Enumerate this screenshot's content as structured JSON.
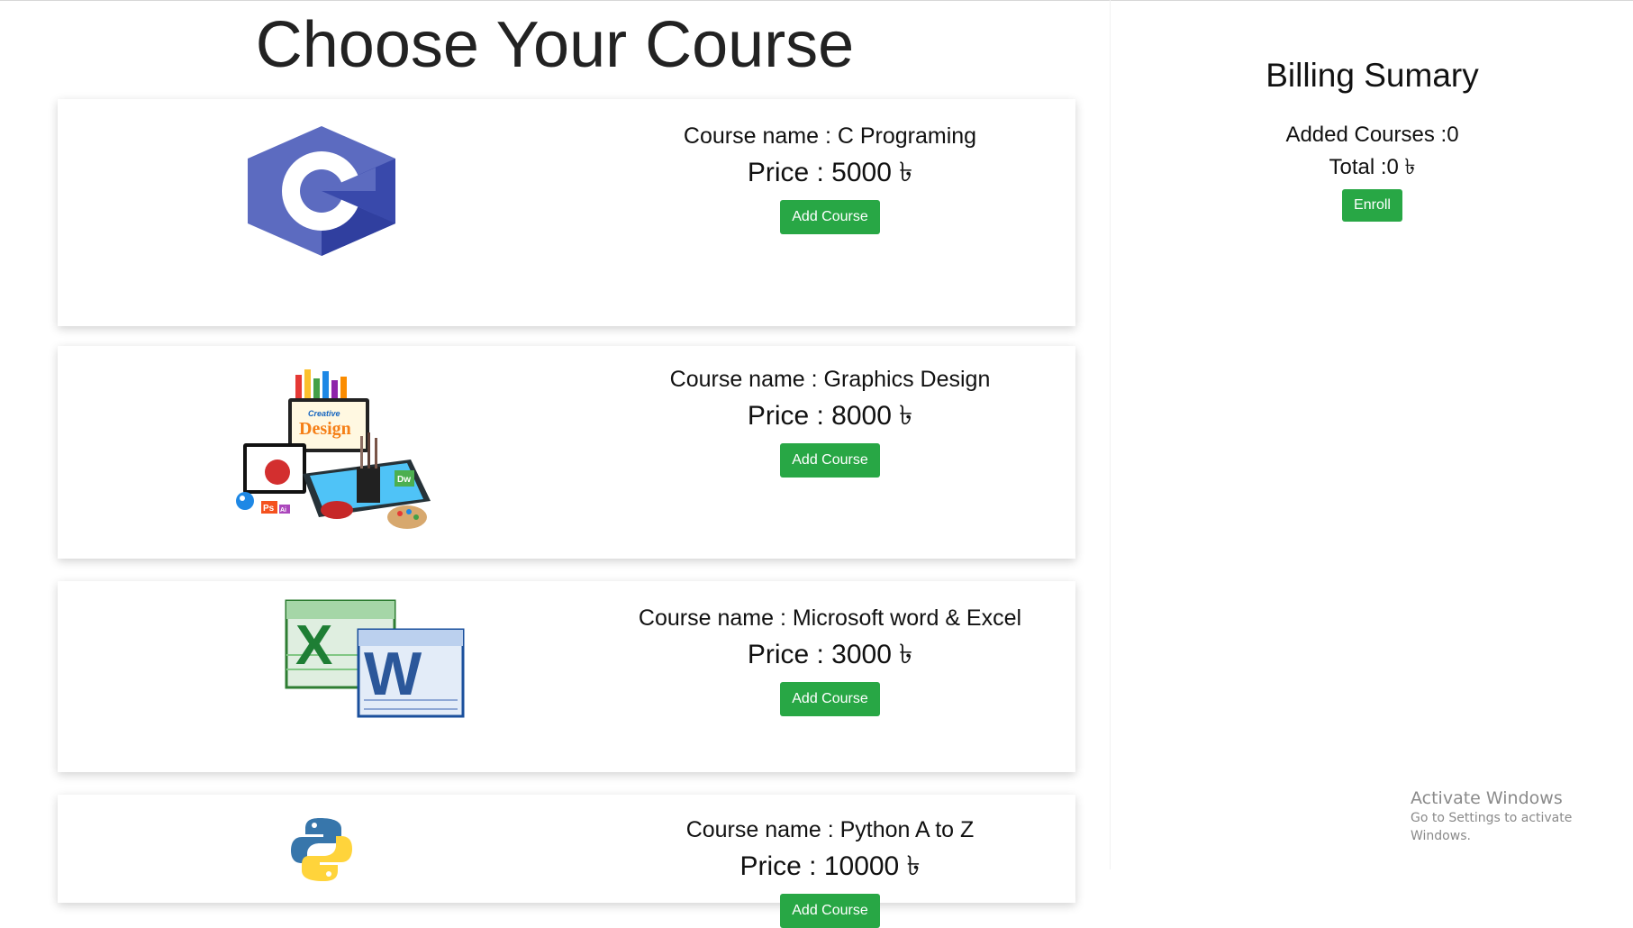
{
  "page": {
    "title": "Choose Your Course"
  },
  "courses": [
    {
      "name": "Course name : C Programing",
      "price": "Price : 5000 ৳",
      "button": "Add Course",
      "icon": "c-language-logo-icon"
    },
    {
      "name": "Course name : Graphics Design",
      "price": "Price : 8000 ৳",
      "button": "Add Course",
      "icon": "graphics-design-illustration-icon",
      "image_text": [
        "Creative",
        "Design",
        "Dw",
        "Ps",
        "Ai"
      ]
    },
    {
      "name": "Course name : Microsoft word & Excel",
      "price": "Price : 3000 ৳",
      "button": "Add Course",
      "icon": "word-excel-logo-icon",
      "image_text": [
        "X",
        "W"
      ]
    },
    {
      "name": "Course name : Python A to Z",
      "price": "Price : 10000 ৳",
      "button": "Add Course",
      "icon": "python-logo-icon"
    }
  ],
  "billing": {
    "title": "Billing Sumary",
    "added_courses": "Added Courses :0",
    "total": "Total :0 ৳",
    "enroll": "Enroll"
  },
  "watermark": {
    "line1": "Activate Windows",
    "line2": "Go to Settings to activate Windows."
  },
  "colors": {
    "button_green": "#28a745",
    "c_logo_blue": "#5c6bc0",
    "c_logo_dark": "#3949ab",
    "excel_green": "#1e7e34",
    "word_blue": "#2b579a",
    "python_blue": "#3776ab",
    "python_yellow": "#ffd43b"
  }
}
